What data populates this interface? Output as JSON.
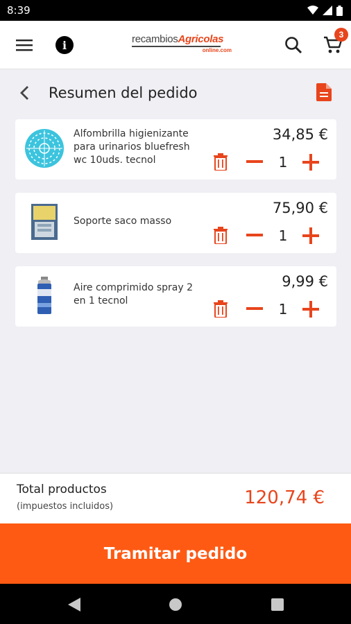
{
  "status_bar": {
    "time": "8:39",
    "icons": [
      "wifi-icon",
      "signal-icon",
      "battery-icon"
    ]
  },
  "header": {
    "logo_part1": "recambios",
    "logo_part2": "Agricolas",
    "logo_sub": "online.com",
    "cart_count": "3",
    "icons": [
      "menu-icon",
      "info-icon",
      "search-icon",
      "cart-icon"
    ]
  },
  "page": {
    "title": "Resumen del pedido",
    "icons": [
      "back-chevron-icon",
      "document-icon"
    ]
  },
  "products": [
    {
      "name": "Alfombrilla higienizante para urinarios bluefresh wc 10uds. tecnol",
      "price": "34,85 €",
      "quantity": "1",
      "thumb_icon": "urinal-mat-icon"
    },
    {
      "name": "Soporte saco masso",
      "price": "75,90 €",
      "quantity": "1",
      "thumb_icon": "bag-holder-icon"
    },
    {
      "name": "Aire comprimido spray 2 en 1 tecnol",
      "price": "9,99 €",
      "quantity": "1",
      "thumb_icon": "spray-can-icon"
    }
  ],
  "totals": {
    "label": "Total productos",
    "sublabel": "(impuestos incluidos)",
    "amount": "120,74 €"
  },
  "checkout": {
    "label": "Tramitar pedido"
  },
  "colors": {
    "accent": "#e8451c",
    "checkout_bg": "#ff5a13",
    "background": "#efeff4"
  }
}
